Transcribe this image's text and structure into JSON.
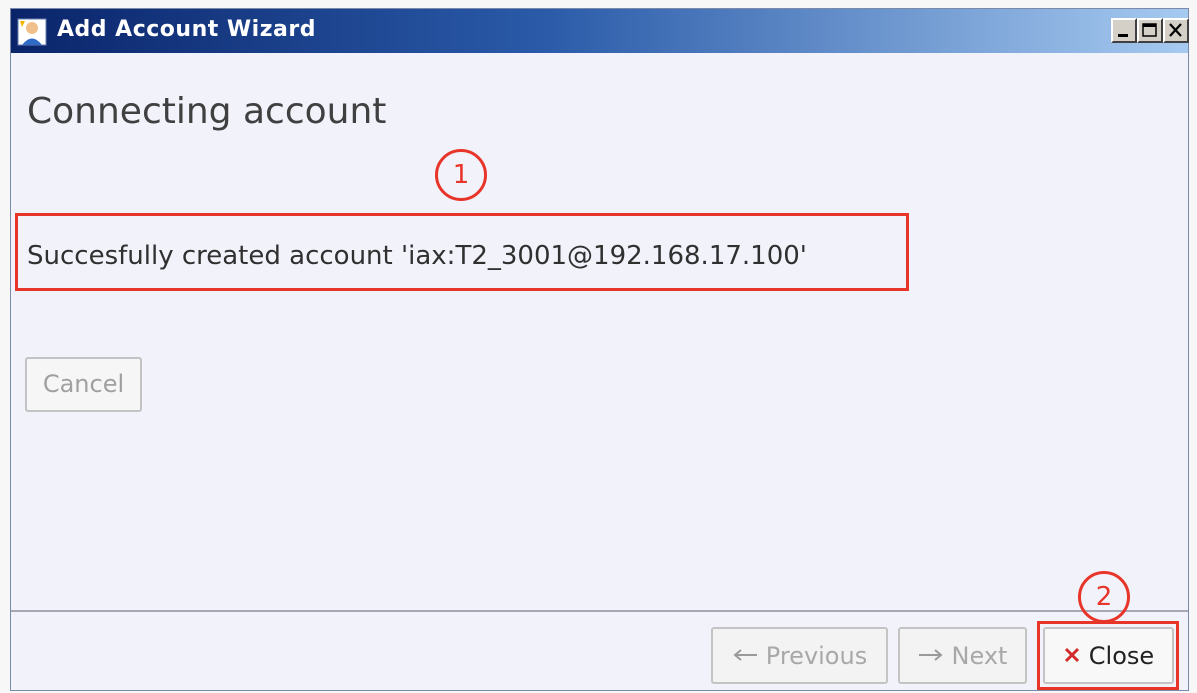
{
  "window": {
    "title": "Add Account Wizard",
    "icon": "user-wizard-icon",
    "controls": {
      "minimize": "minimize-icon",
      "maximize": "maximize-icon",
      "close": "close-icon"
    }
  },
  "page": {
    "heading": "Connecting account",
    "message": "Succesfully created account 'iax:T2_3001@192.168.17.100'"
  },
  "buttons": {
    "cancel_label": "Cancel",
    "previous_label": "Previous",
    "next_label": "Next",
    "close_label": "Close"
  },
  "annotations": {
    "badge_1": "1",
    "badge_2": "2"
  },
  "colors": {
    "highlight": "#e8352a",
    "titlebar_start": "#0a246a",
    "titlebar_end": "#a6caf0"
  }
}
